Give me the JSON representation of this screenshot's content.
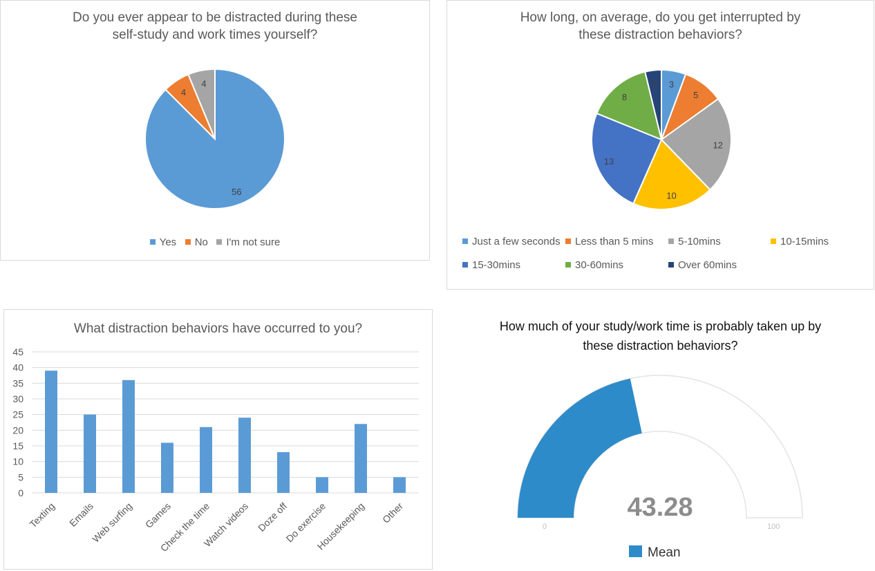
{
  "colors": {
    "blue": "#5b9bd5",
    "orange": "#ed7d31",
    "gray": "#a5a5a5",
    "gold": "#ffc000",
    "darkblue": "#4472c4",
    "green": "#70ad47",
    "navy": "#264478",
    "bar": "#5b9bd5",
    "gauge": "#2e8bc9"
  },
  "chart_data": [
    {
      "type": "pie",
      "title": "Do you ever appear to be distracted during these self-study and work times yourself?",
      "title_lines": [
        "Do you ever appear to be distracted during these",
        "self-study and work times yourself?"
      ],
      "categories": [
        "Yes",
        "No",
        "I'm not sure"
      ],
      "values": [
        56,
        4,
        4
      ],
      "legend_position": "bottom"
    },
    {
      "type": "pie",
      "title": "How long, on average, do you get interrupted by these distraction behaviors?",
      "title_lines": [
        "How long, on average, do you get interrupted by",
        "these distraction behaviors?"
      ],
      "categories": [
        "Just a few seconds",
        "Less than 5 mins",
        "5-10mins",
        "10-15mins",
        "15-30mins",
        "30-60mins",
        "Over 60mins"
      ],
      "values": [
        3,
        5,
        12,
        10,
        13,
        8,
        2
      ],
      "legend_position": "bottom"
    },
    {
      "type": "bar",
      "title": "What distraction behaviors have occurred to you?",
      "categories": [
        "Texting",
        "Emails",
        "Web surfing",
        "Games",
        "Check the time",
        "Watch videos",
        "Doze off",
        "Do exercise",
        "Housekeeping",
        "Other"
      ],
      "values": [
        39,
        25,
        36,
        16,
        21,
        24,
        13,
        5,
        22,
        5
      ],
      "ylim": [
        0,
        45
      ],
      "yticks": [
        0,
        5,
        10,
        15,
        20,
        25,
        30,
        35,
        40,
        45
      ],
      "grid": true
    },
    {
      "type": "gauge",
      "title": "How much of your study/work time is probably taken up by these distraction behaviors?",
      "title_lines": [
        "How much of your study/work time is probably taken up by",
        "these distraction behaviors?"
      ],
      "value": 43.28,
      "value_label": "43.28",
      "min": 0,
      "max": 100,
      "min_label": "0",
      "max_label": "100",
      "legend": [
        "Mean"
      ]
    }
  ]
}
